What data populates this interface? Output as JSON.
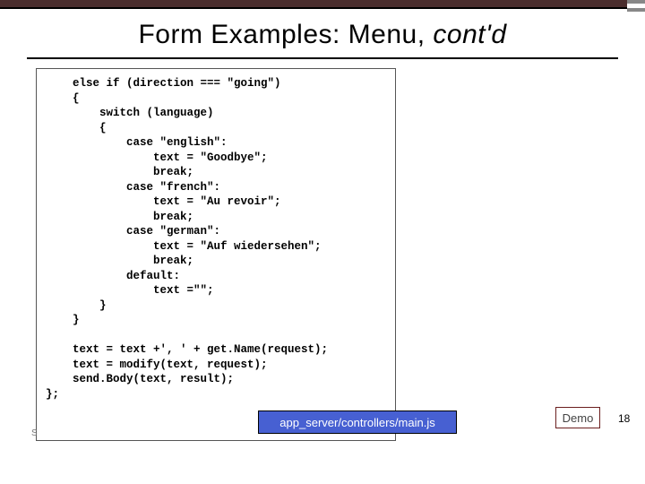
{
  "slide": {
    "title_prefix": "Form Examples: Menu, ",
    "title_ital": "cont'd",
    "code": "    else if (direction === \"going\")\n    {\n        switch (language)\n        {\n            case \"english\":\n                text = \"Goodbye\";\n                break;\n            case \"french\":\n                text = \"Au revoir\";\n                break;\n            case \"german\":\n                text = \"Auf wiedersehen\";\n                break;\n            default:\n                text =\"\";\n        }\n    }\n\n    text = text +', ' + get.Name(request);\n    text = modify(text, request);\n    send.Body(text, result);\n};",
    "path": "app_server/controllers/main.js",
    "demo_label": "Demo",
    "page_number": "18",
    "footer_partial": "S"
  }
}
